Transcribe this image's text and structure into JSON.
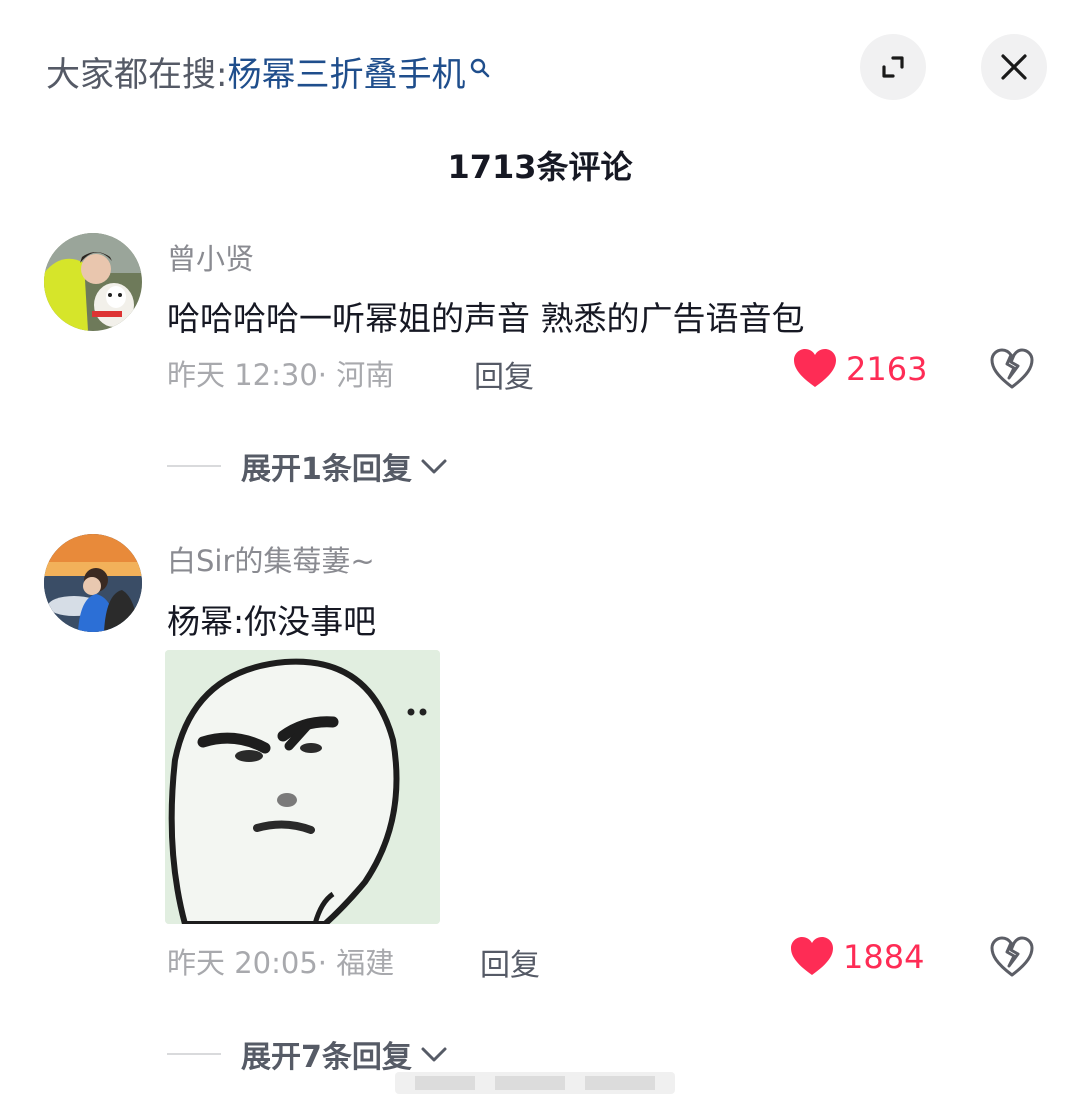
{
  "header": {
    "search_prefix": "大家都在搜:",
    "search_term": "杨幂三折叠手机",
    "expand_icon": "expand-icon",
    "close_icon": "close-icon"
  },
  "comment_count": "1713条评论",
  "comments": [
    {
      "username": "曾小贤",
      "text": "哈哈哈哈一听幂姐的声音 熟悉的广告语音包",
      "time": "昨天 12:30",
      "location": "· 河南",
      "reply_label": "回复",
      "likes": "2163",
      "expand_label": "展开1条回复"
    },
    {
      "username": "白Sir的集莓萋~",
      "text": "杨幂:你没事吧",
      "time": "昨天 20:05",
      "location": "· 福建",
      "reply_label": "回复",
      "likes": "1884",
      "expand_label": "展开7条回复"
    }
  ],
  "colors": {
    "accent_like": "#fe2c55",
    "search_term": "#1f4e8c",
    "text_primary": "#161823",
    "text_secondary": "#8a8b91"
  }
}
